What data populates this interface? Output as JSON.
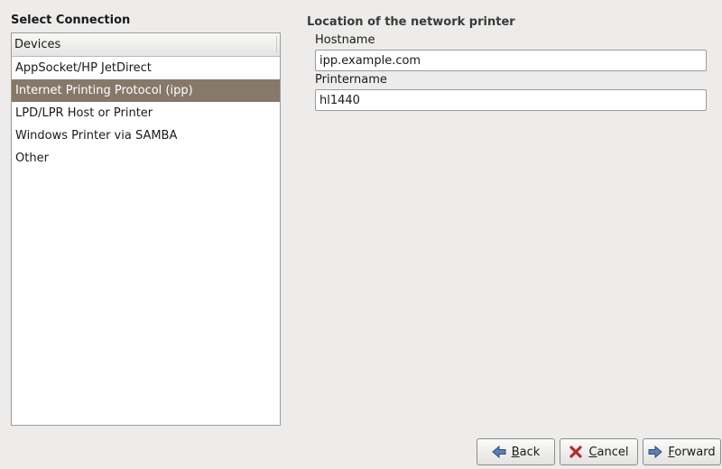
{
  "left_panel": {
    "title": "Select Connection",
    "list_header": "Devices",
    "items": [
      {
        "label": "AppSocket/HP JetDirect",
        "selected": false
      },
      {
        "label": "Internet Printing Protocol (ipp)",
        "selected": true
      },
      {
        "label": "LPD/LPR Host or Printer",
        "selected": false
      },
      {
        "label": "Windows Printer via SAMBA",
        "selected": false
      },
      {
        "label": "Other",
        "selected": false
      }
    ]
  },
  "right_panel": {
    "title": "Location of the network printer",
    "hostname_label": "Hostname",
    "hostname_value": "ipp.example.com",
    "printername_label": "Printername",
    "printername_value": "hl1440"
  },
  "buttons": {
    "back": {
      "mnemonic": "B",
      "rest": "ack",
      "icon": "arrow-left-icon"
    },
    "cancel": {
      "mnemonic": "C",
      "rest": "ancel",
      "icon": "cancel-x-icon"
    },
    "forward": {
      "mnemonic": "F",
      "rest": "orward",
      "icon": "arrow-right-icon"
    }
  },
  "colors": {
    "selection": "#86796a",
    "window_bg": "#edeceb"
  }
}
